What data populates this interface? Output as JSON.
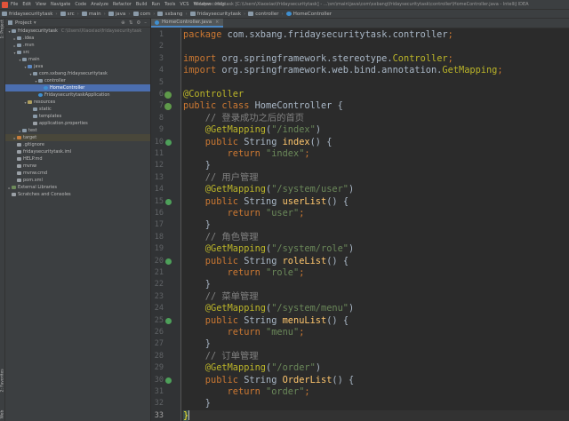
{
  "window": {
    "menu": [
      "File",
      "Edit",
      "View",
      "Navigate",
      "Code",
      "Analyze",
      "Refactor",
      "Build",
      "Run",
      "Tools",
      "VCS",
      "Window",
      "Help"
    ],
    "title": "fridaysecuritytask [C:\\Users\\Xiaoxiao\\fridaysecuritytask] - ...\\src\\main\\java\\com\\sxbang\\fridaysecuritytask\\controller\\HomeController.java - IntelliJ IDEA"
  },
  "breadcrumbs": [
    "fridaysecuritytask",
    "src",
    "main",
    "java",
    "com",
    "sxbang",
    "fridaysecuritytask",
    "controller",
    "HomeController"
  ],
  "tool_strip": {
    "left_top": "1: Project",
    "left_mid": "2: Structure",
    "left_bottom": "2: Favorites",
    "left_web": "Web"
  },
  "project_panel": {
    "header": "Project",
    "tree": [
      {
        "label": "fridaysecuritytask",
        "hint": "C:\\Users\\Xiaoxiao\\fridaysecuritytask",
        "icon": "folder",
        "tri": "open"
      },
      {
        "label": ".idea",
        "icon": "folder",
        "tri": "closed"
      },
      {
        "label": ".mvn",
        "icon": "folder",
        "tri": "closed"
      },
      {
        "label": "src",
        "icon": "folder",
        "tri": "open"
      },
      {
        "label": "main",
        "icon": "folder",
        "tri": "open"
      },
      {
        "label": "java",
        "icon": "src",
        "tri": "open"
      },
      {
        "label": "com.sxbang.fridaysecuritytask",
        "icon": "folder",
        "tri": "open"
      },
      {
        "label": "controller",
        "icon": "folder",
        "tri": "open"
      },
      {
        "label": "HomeController",
        "icon": "class",
        "tri": "",
        "selected": true
      },
      {
        "label": "FridaysecuritytaskApplication",
        "icon": "class",
        "tri": ""
      },
      {
        "label": "resources",
        "icon": "res",
        "tri": "open"
      },
      {
        "label": "static",
        "icon": "folder",
        "tri": ""
      },
      {
        "label": "templates",
        "icon": "folder",
        "tri": ""
      },
      {
        "label": "application.properties",
        "icon": "file",
        "tri": ""
      },
      {
        "label": "test",
        "icon": "folder",
        "tri": "closed"
      },
      {
        "label": "target",
        "icon": "target",
        "tri": "closed",
        "excluded": true
      },
      {
        "label": ".gitignore",
        "icon": "file",
        "tri": ""
      },
      {
        "label": "fridaysecuritytask.iml",
        "icon": "file",
        "tri": ""
      },
      {
        "label": "HELP.md",
        "icon": "file",
        "tri": ""
      },
      {
        "label": "mvnw",
        "icon": "file",
        "tri": ""
      },
      {
        "label": "mvnw.cmd",
        "icon": "file",
        "tri": ""
      },
      {
        "label": "pom.xml",
        "icon": "file",
        "tri": ""
      },
      {
        "label": "External Libraries",
        "icon": "lib",
        "tri": "closed"
      },
      {
        "label": "Scratches and Consoles",
        "icon": "file",
        "tri": ""
      }
    ]
  },
  "editor": {
    "tab": "HomeController.java",
    "current_line": 33,
    "lines": [
      {
        "n": 1,
        "t": [
          [
            "kw",
            "package "
          ],
          [
            "pkg",
            "com.sxbang.fridaysecuritytask.controller"
          ],
          [
            "kw",
            ";"
          ]
        ]
      },
      {
        "n": 2,
        "t": []
      },
      {
        "n": 3,
        "t": [
          [
            "kw",
            "import "
          ],
          [
            "pkg",
            "org.springframework.stereotype."
          ],
          [
            "ann",
            "Controller"
          ],
          [
            "kw",
            ";"
          ]
        ]
      },
      {
        "n": 4,
        "t": [
          [
            "kw",
            "import "
          ],
          [
            "pkg",
            "org.springframework.web.bind.annotation."
          ],
          [
            "ann",
            "GetMapping"
          ],
          [
            "kw",
            ";"
          ]
        ]
      },
      {
        "n": 5,
        "t": []
      },
      {
        "n": 6,
        "t": [
          [
            "ann",
            "@Controller"
          ]
        ],
        "mark": "bean"
      },
      {
        "n": 7,
        "t": [
          [
            "kw",
            "public class "
          ],
          [
            "pkg",
            "HomeController "
          ],
          [
            "brace",
            "{"
          ]
        ],
        "mark": "bean"
      },
      {
        "n": 8,
        "t": [
          [
            "cmt",
            "    // 登录成功之后的首页"
          ]
        ]
      },
      {
        "n": 9,
        "t": [
          [
            "ann",
            "    @GetMapping"
          ],
          [
            "pkg",
            "("
          ],
          [
            "str",
            "\"/index\""
          ],
          [
            "pkg",
            ")"
          ]
        ]
      },
      {
        "n": 10,
        "t": [
          [
            "kw",
            "    public "
          ],
          [
            "pkg",
            "String "
          ],
          [
            "fn",
            "index"
          ],
          [
            "pkg",
            "() {"
          ]
        ],
        "mark": "web"
      },
      {
        "n": 11,
        "t": [
          [
            "kw",
            "        return "
          ],
          [
            "str",
            "\"index\""
          ],
          [
            "kw",
            ";"
          ]
        ]
      },
      {
        "n": 12,
        "t": [
          [
            "pkg",
            "    }"
          ]
        ]
      },
      {
        "n": 13,
        "t": [
          [
            "cmt",
            "    // 用户管理"
          ]
        ]
      },
      {
        "n": 14,
        "t": [
          [
            "ann",
            "    @GetMapping"
          ],
          [
            "pkg",
            "("
          ],
          [
            "str",
            "\"/system/user\""
          ],
          [
            "pkg",
            ")"
          ]
        ]
      },
      {
        "n": 15,
        "t": [
          [
            "kw",
            "    public "
          ],
          [
            "pkg",
            "String "
          ],
          [
            "fn",
            "userList"
          ],
          [
            "pkg",
            "() {"
          ]
        ],
        "mark": "web"
      },
      {
        "n": 16,
        "t": [
          [
            "kw",
            "        return "
          ],
          [
            "str",
            "\"user\""
          ],
          [
            "kw",
            ";"
          ]
        ]
      },
      {
        "n": 17,
        "t": [
          [
            "pkg",
            "    }"
          ]
        ]
      },
      {
        "n": 18,
        "t": [
          [
            "cmt",
            "    // 角色管理"
          ]
        ]
      },
      {
        "n": 19,
        "t": [
          [
            "ann",
            "    @GetMapping"
          ],
          [
            "pkg",
            "("
          ],
          [
            "str",
            "\"/system/role\""
          ],
          [
            "pkg",
            ")"
          ]
        ]
      },
      {
        "n": 20,
        "t": [
          [
            "kw",
            "    public "
          ],
          [
            "pkg",
            "String "
          ],
          [
            "fn",
            "roleList"
          ],
          [
            "pkg",
            "() {"
          ]
        ],
        "mark": "web"
      },
      {
        "n": 21,
        "t": [
          [
            "kw",
            "        return "
          ],
          [
            "str",
            "\"role\""
          ],
          [
            "kw",
            ";"
          ]
        ]
      },
      {
        "n": 22,
        "t": [
          [
            "pkg",
            "    }"
          ]
        ]
      },
      {
        "n": 23,
        "t": [
          [
            "cmt",
            "    // 菜单管理"
          ]
        ]
      },
      {
        "n": 24,
        "t": [
          [
            "ann",
            "    @GetMapping"
          ],
          [
            "pkg",
            "("
          ],
          [
            "str",
            "\"/system/menu\""
          ],
          [
            "pkg",
            ")"
          ]
        ]
      },
      {
        "n": 25,
        "t": [
          [
            "kw",
            "    public "
          ],
          [
            "pkg",
            "String "
          ],
          [
            "fn",
            "menuList"
          ],
          [
            "pkg",
            "() {"
          ]
        ],
        "mark": "web"
      },
      {
        "n": 26,
        "t": [
          [
            "kw",
            "        return "
          ],
          [
            "str",
            "\"menu\""
          ],
          [
            "kw",
            ";"
          ]
        ]
      },
      {
        "n": 27,
        "t": [
          [
            "pkg",
            "    }"
          ]
        ]
      },
      {
        "n": 28,
        "t": [
          [
            "cmt",
            "    // 订单管理"
          ]
        ]
      },
      {
        "n": 29,
        "t": [
          [
            "ann",
            "    @GetMapping"
          ],
          [
            "pkg",
            "("
          ],
          [
            "str",
            "\"/order\""
          ],
          [
            "pkg",
            ")"
          ]
        ]
      },
      {
        "n": 30,
        "t": [
          [
            "kw",
            "    public "
          ],
          [
            "pkg",
            "String "
          ],
          [
            "fn",
            "OrderList"
          ],
          [
            "pkg",
            "() {"
          ]
        ],
        "mark": "web"
      },
      {
        "n": 31,
        "t": [
          [
            "kw",
            "        return "
          ],
          [
            "str",
            "\"order\""
          ],
          [
            "kw",
            ";"
          ]
        ]
      },
      {
        "n": 32,
        "t": [
          [
            "pkg",
            "    }"
          ]
        ]
      },
      {
        "n": 33,
        "t": [
          [
            "brace",
            "}"
          ]
        ]
      }
    ]
  },
  "colors": {
    "keyword": "#cc7832",
    "annotation": "#bbb529",
    "string": "#6a8759",
    "comment": "#808080",
    "method": "#ffc66d",
    "selection": "#4b6eaf"
  }
}
